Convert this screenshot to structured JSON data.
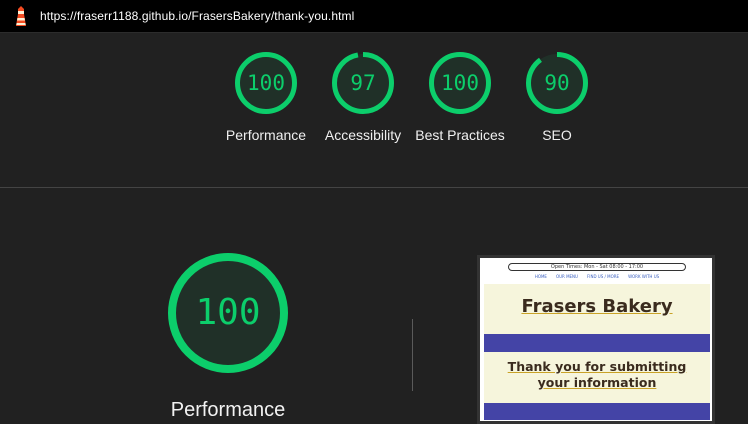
{
  "topbar": {
    "url": "https://fraserr1188.github.io/FrasersBakery/thank-you.html",
    "icon": "lighthouse-icon"
  },
  "colors": {
    "pass": "#0cce6b",
    "background": "#212121",
    "topbar": "#000000"
  },
  "scores": [
    {
      "value": "100",
      "label": "Performance",
      "fraction": 1.0
    },
    {
      "value": "97",
      "label": "Accessibility",
      "fraction": 0.97
    },
    {
      "value": "100",
      "label": "Best Practices",
      "fraction": 1.0
    },
    {
      "value": "90",
      "label": "SEO",
      "fraction": 0.9
    }
  ],
  "detail": {
    "score": "100",
    "label": "Performance",
    "fraction": 1.0
  },
  "preview": {
    "open_times": "Open Times: Mon - Sat 08:00 - 17:00",
    "nav": [
      "HOME",
      "OUR MENU",
      "FIND US / MORE",
      "WORK WITH US"
    ],
    "brand": "Frasers Bakery",
    "message": "Thank you for submitting your information"
  }
}
